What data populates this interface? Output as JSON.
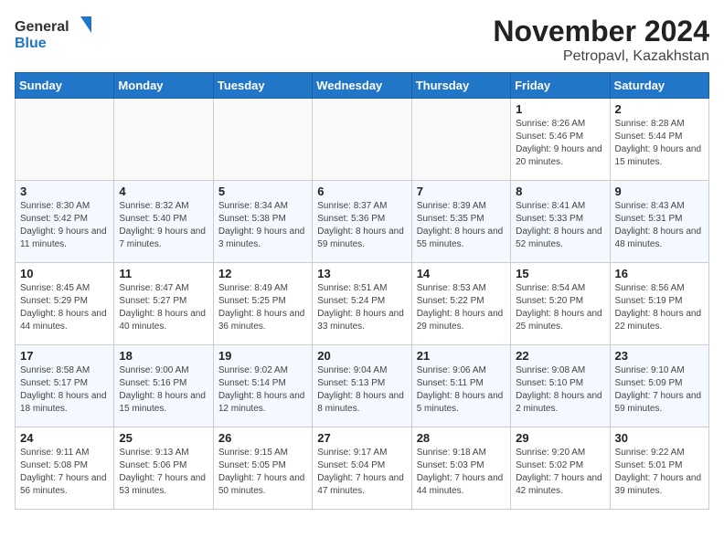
{
  "logo": {
    "general": "General",
    "blue": "Blue"
  },
  "title": "November 2024",
  "subtitle": "Petropavl, Kazakhstan",
  "days_of_week": [
    "Sunday",
    "Monday",
    "Tuesday",
    "Wednesday",
    "Thursday",
    "Friday",
    "Saturday"
  ],
  "weeks": [
    [
      {
        "day": "",
        "info": ""
      },
      {
        "day": "",
        "info": ""
      },
      {
        "day": "",
        "info": ""
      },
      {
        "day": "",
        "info": ""
      },
      {
        "day": "",
        "info": ""
      },
      {
        "day": "1",
        "info": "Sunrise: 8:26 AM\nSunset: 5:46 PM\nDaylight: 9 hours and 20 minutes."
      },
      {
        "day": "2",
        "info": "Sunrise: 8:28 AM\nSunset: 5:44 PM\nDaylight: 9 hours and 15 minutes."
      }
    ],
    [
      {
        "day": "3",
        "info": "Sunrise: 8:30 AM\nSunset: 5:42 PM\nDaylight: 9 hours and 11 minutes."
      },
      {
        "day": "4",
        "info": "Sunrise: 8:32 AM\nSunset: 5:40 PM\nDaylight: 9 hours and 7 minutes."
      },
      {
        "day": "5",
        "info": "Sunrise: 8:34 AM\nSunset: 5:38 PM\nDaylight: 9 hours and 3 minutes."
      },
      {
        "day": "6",
        "info": "Sunrise: 8:37 AM\nSunset: 5:36 PM\nDaylight: 8 hours and 59 minutes."
      },
      {
        "day": "7",
        "info": "Sunrise: 8:39 AM\nSunset: 5:35 PM\nDaylight: 8 hours and 55 minutes."
      },
      {
        "day": "8",
        "info": "Sunrise: 8:41 AM\nSunset: 5:33 PM\nDaylight: 8 hours and 52 minutes."
      },
      {
        "day": "9",
        "info": "Sunrise: 8:43 AM\nSunset: 5:31 PM\nDaylight: 8 hours and 48 minutes."
      }
    ],
    [
      {
        "day": "10",
        "info": "Sunrise: 8:45 AM\nSunset: 5:29 PM\nDaylight: 8 hours and 44 minutes."
      },
      {
        "day": "11",
        "info": "Sunrise: 8:47 AM\nSunset: 5:27 PM\nDaylight: 8 hours and 40 minutes."
      },
      {
        "day": "12",
        "info": "Sunrise: 8:49 AM\nSunset: 5:25 PM\nDaylight: 8 hours and 36 minutes."
      },
      {
        "day": "13",
        "info": "Sunrise: 8:51 AM\nSunset: 5:24 PM\nDaylight: 8 hours and 33 minutes."
      },
      {
        "day": "14",
        "info": "Sunrise: 8:53 AM\nSunset: 5:22 PM\nDaylight: 8 hours and 29 minutes."
      },
      {
        "day": "15",
        "info": "Sunrise: 8:54 AM\nSunset: 5:20 PM\nDaylight: 8 hours and 25 minutes."
      },
      {
        "day": "16",
        "info": "Sunrise: 8:56 AM\nSunset: 5:19 PM\nDaylight: 8 hours and 22 minutes."
      }
    ],
    [
      {
        "day": "17",
        "info": "Sunrise: 8:58 AM\nSunset: 5:17 PM\nDaylight: 8 hours and 18 minutes."
      },
      {
        "day": "18",
        "info": "Sunrise: 9:00 AM\nSunset: 5:16 PM\nDaylight: 8 hours and 15 minutes."
      },
      {
        "day": "19",
        "info": "Sunrise: 9:02 AM\nSunset: 5:14 PM\nDaylight: 8 hours and 12 minutes."
      },
      {
        "day": "20",
        "info": "Sunrise: 9:04 AM\nSunset: 5:13 PM\nDaylight: 8 hours and 8 minutes."
      },
      {
        "day": "21",
        "info": "Sunrise: 9:06 AM\nSunset: 5:11 PM\nDaylight: 8 hours and 5 minutes."
      },
      {
        "day": "22",
        "info": "Sunrise: 9:08 AM\nSunset: 5:10 PM\nDaylight: 8 hours and 2 minutes."
      },
      {
        "day": "23",
        "info": "Sunrise: 9:10 AM\nSunset: 5:09 PM\nDaylight: 7 hours and 59 minutes."
      }
    ],
    [
      {
        "day": "24",
        "info": "Sunrise: 9:11 AM\nSunset: 5:08 PM\nDaylight: 7 hours and 56 minutes."
      },
      {
        "day": "25",
        "info": "Sunrise: 9:13 AM\nSunset: 5:06 PM\nDaylight: 7 hours and 53 minutes."
      },
      {
        "day": "26",
        "info": "Sunrise: 9:15 AM\nSunset: 5:05 PM\nDaylight: 7 hours and 50 minutes."
      },
      {
        "day": "27",
        "info": "Sunrise: 9:17 AM\nSunset: 5:04 PM\nDaylight: 7 hours and 47 minutes."
      },
      {
        "day": "28",
        "info": "Sunrise: 9:18 AM\nSunset: 5:03 PM\nDaylight: 7 hours and 44 minutes."
      },
      {
        "day": "29",
        "info": "Sunrise: 9:20 AM\nSunset: 5:02 PM\nDaylight: 7 hours and 42 minutes."
      },
      {
        "day": "30",
        "info": "Sunrise: 9:22 AM\nSunset: 5:01 PM\nDaylight: 7 hours and 39 minutes."
      }
    ]
  ]
}
